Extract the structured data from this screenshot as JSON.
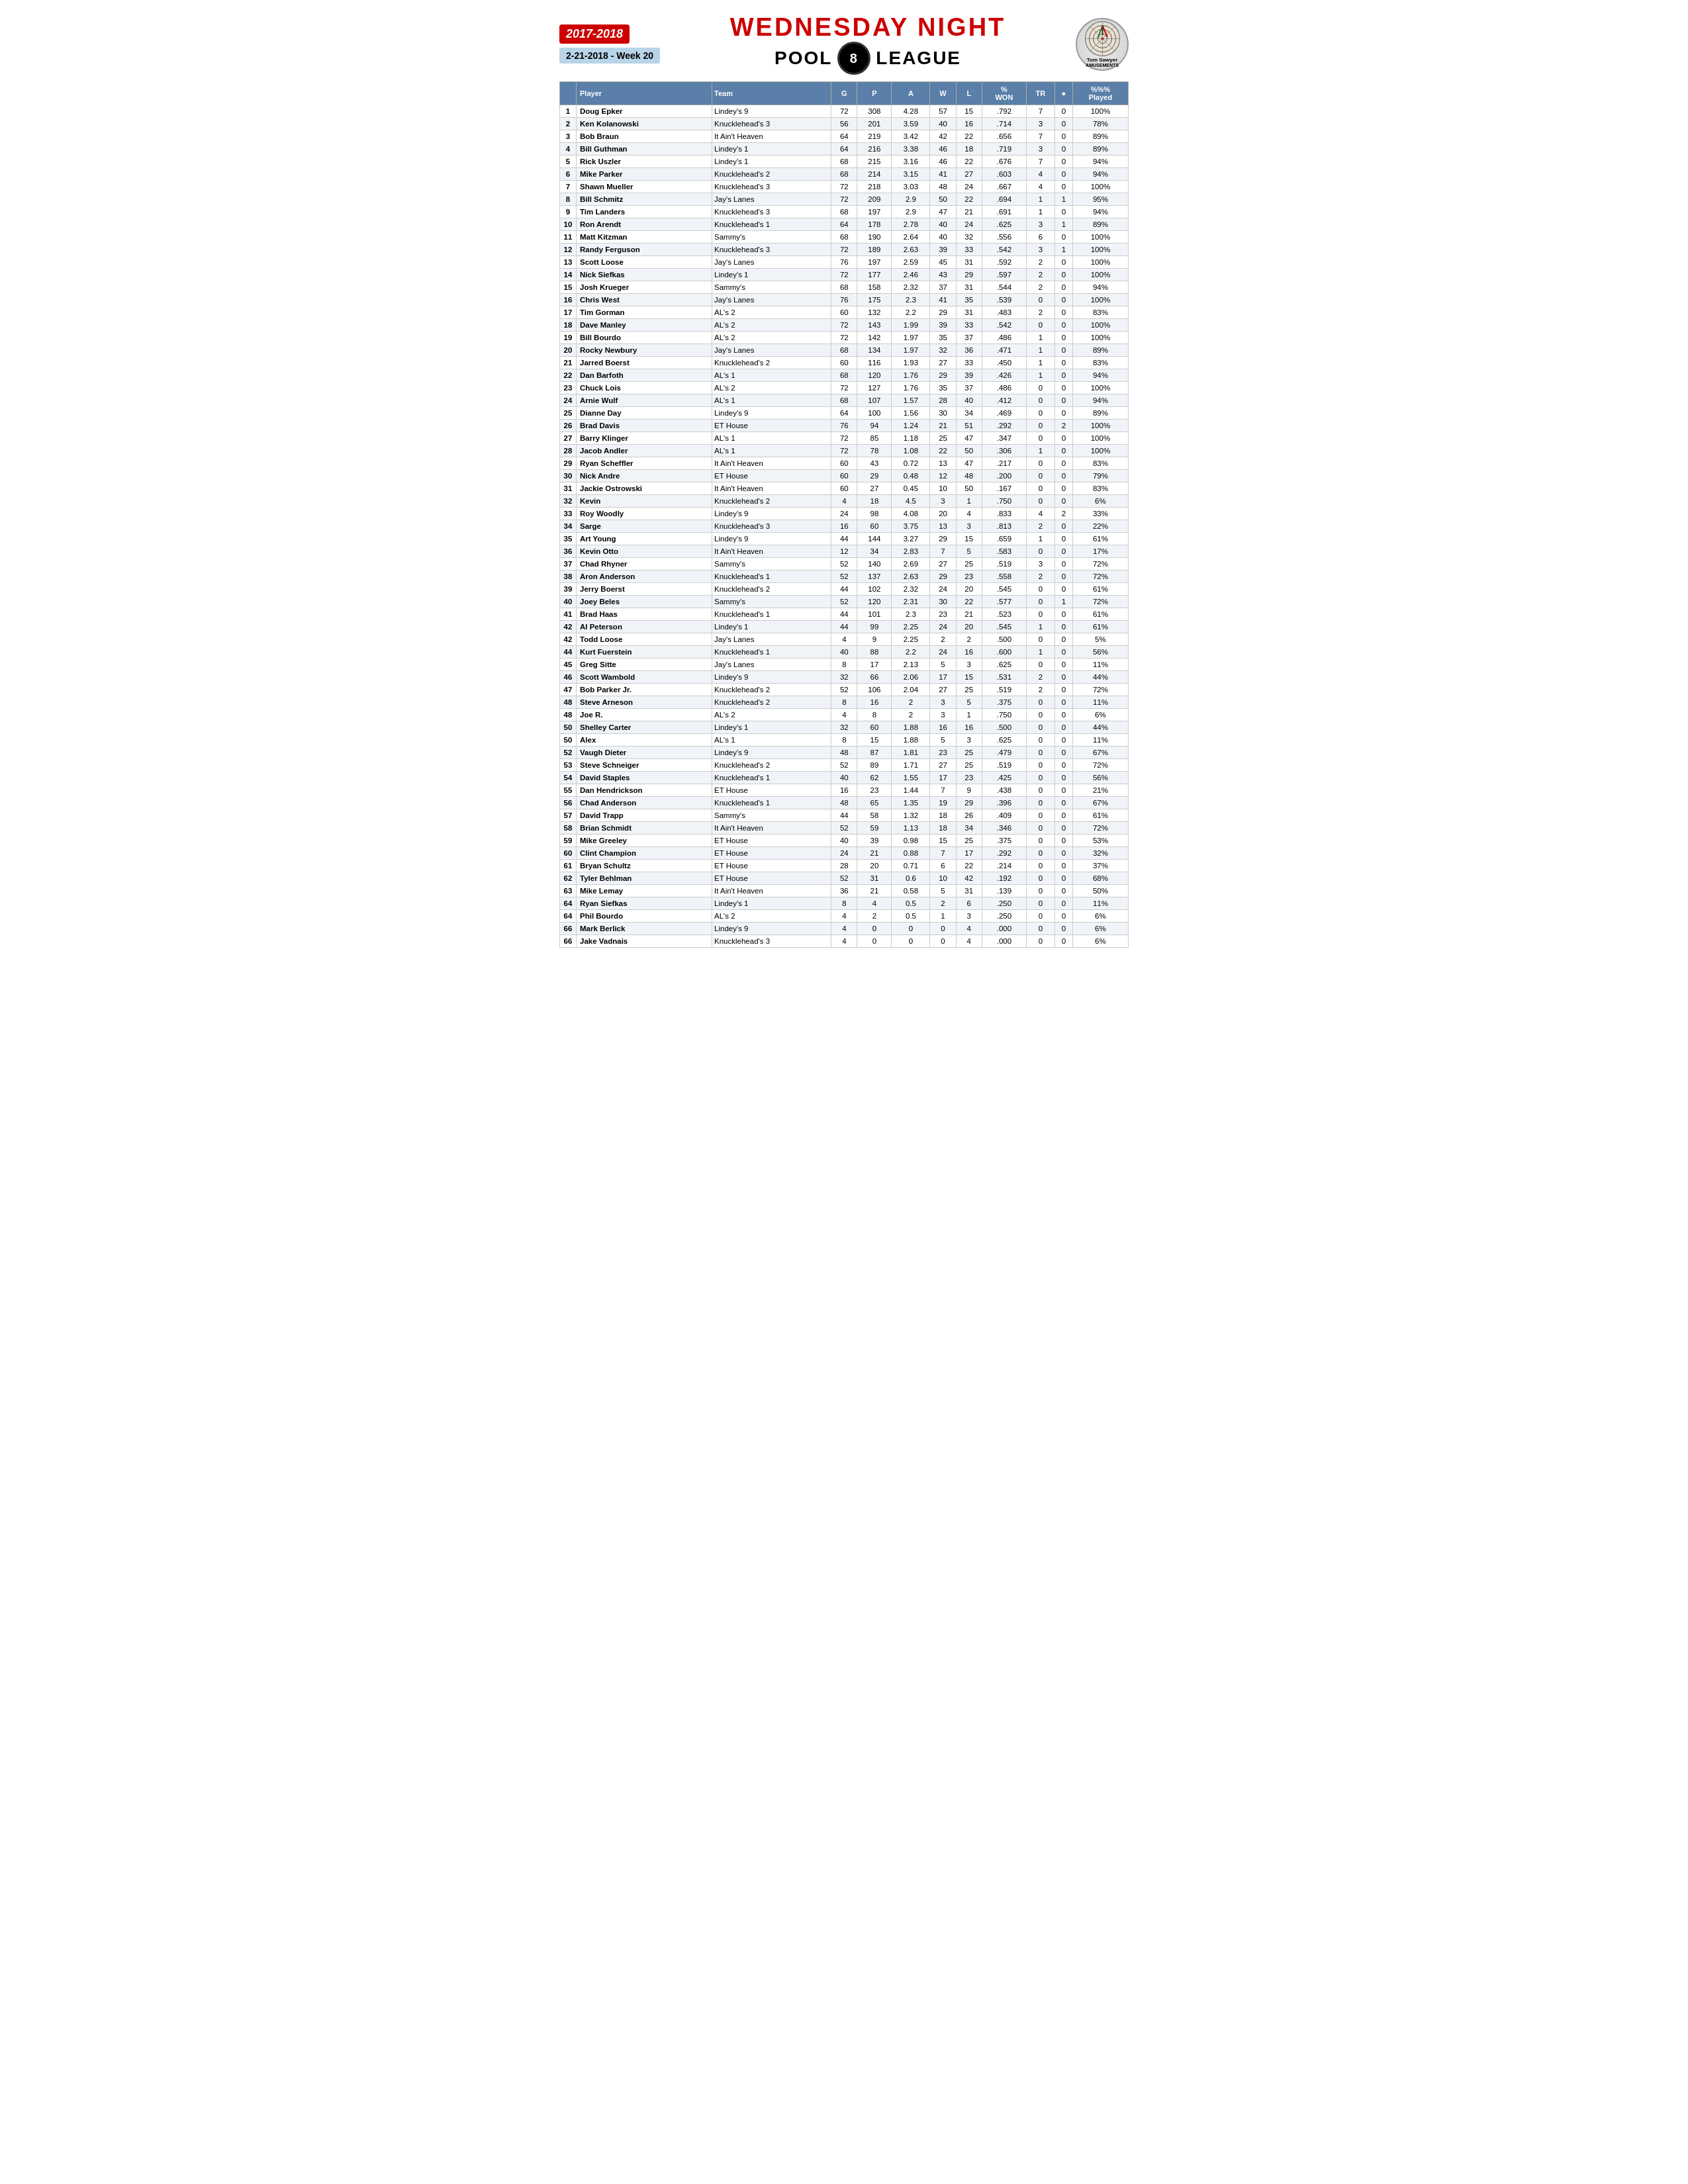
{
  "header": {
    "year": "2017-2018",
    "title_line1": "WEDNESDAY NIGHT",
    "title_line2": "POOL",
    "title_line3": "LEAGUE",
    "date": "2-21-2018 - Week 20",
    "sponsor": "Tom Sawyer",
    "sponsor_sub": "AMUSEMENTS"
  },
  "table": {
    "columns": [
      "",
      "Player",
      "Team",
      "G",
      "P",
      "A",
      "W",
      "L",
      "% WON",
      "TR",
      "8",
      "%%% Played"
    ],
    "rows": [
      [
        1,
        "Doug Epker",
        "Lindey's 9",
        72,
        308,
        4.28,
        57,
        15,
        ".792",
        7,
        0,
        "100%"
      ],
      [
        2,
        "Ken Kolanowski",
        "Knucklehead's 3",
        56,
        201,
        3.59,
        40,
        16,
        ".714",
        3,
        0,
        "78%"
      ],
      [
        3,
        "Bob Braun",
        "It Ain't Heaven",
        64,
        219,
        3.42,
        42,
        22,
        ".656",
        7,
        0,
        "89%"
      ],
      [
        4,
        "Bill Guthman",
        "Lindey's 1",
        64,
        216,
        3.38,
        46,
        18,
        ".719",
        3,
        0,
        "89%"
      ],
      [
        5,
        "Rick Uszler",
        "Lindey's 1",
        68,
        215,
        3.16,
        46,
        22,
        ".676",
        7,
        0,
        "94%"
      ],
      [
        6,
        "Mike Parker",
        "Knucklehead's 2",
        68,
        214,
        3.15,
        41,
        27,
        ".603",
        4,
        0,
        "94%"
      ],
      [
        7,
        "Shawn Mueller",
        "Knucklehead's 3",
        72,
        218,
        3.03,
        48,
        24,
        ".667",
        4,
        0,
        "100%"
      ],
      [
        8,
        "Bill Schmitz",
        "Jay's Lanes",
        72,
        209,
        2.9,
        50,
        22,
        ".694",
        1,
        1,
        "95%"
      ],
      [
        9,
        "Tim Landers",
        "Knucklehead's 3",
        68,
        197,
        2.9,
        47,
        21,
        ".691",
        1,
        0,
        "94%"
      ],
      [
        10,
        "Ron Arendt",
        "Knucklehead's 1",
        64,
        178,
        2.78,
        40,
        24,
        ".625",
        3,
        1,
        "89%"
      ],
      [
        11,
        "Matt Kitzman",
        "Sammy's",
        68,
        190,
        2.64,
        40,
        32,
        ".556",
        6,
        0,
        "100%"
      ],
      [
        12,
        "Randy Ferguson",
        "Knucklehead's 3",
        72,
        189,
        2.63,
        39,
        33,
        ".542",
        3,
        1,
        "100%"
      ],
      [
        13,
        "Scott Loose",
        "Jay's Lanes",
        76,
        197,
        2.59,
        45,
        31,
        ".592",
        2,
        0,
        "100%"
      ],
      [
        14,
        "Nick Siefkas",
        "Lindey's 1",
        72,
        177,
        2.46,
        43,
        29,
        ".597",
        2,
        0,
        "100%"
      ],
      [
        15,
        "Josh Krueger",
        "Sammy's",
        68,
        158,
        2.32,
        37,
        31,
        ".544",
        2,
        0,
        "94%"
      ],
      [
        16,
        "Chris West",
        "Jay's Lanes",
        76,
        175,
        2.3,
        41,
        35,
        ".539",
        0,
        0,
        "100%"
      ],
      [
        17,
        "Tim Gorman",
        "AL's 2",
        60,
        132,
        2.2,
        29,
        31,
        ".483",
        2,
        0,
        "83%"
      ],
      [
        18,
        "Dave Manley",
        "AL's 2",
        72,
        143,
        1.99,
        39,
        33,
        ".542",
        0,
        0,
        "100%"
      ],
      [
        19,
        "Bill Bourdo",
        "AL's 2",
        72,
        142,
        1.97,
        35,
        37,
        ".486",
        1,
        0,
        "100%"
      ],
      [
        20,
        "Rocky Newbury",
        "Jay's Lanes",
        68,
        134,
        1.97,
        32,
        36,
        ".471",
        1,
        0,
        "89%"
      ],
      [
        21,
        "Jarred Boerst",
        "Knucklehead's 2",
        60,
        116,
        1.93,
        27,
        33,
        ".450",
        1,
        0,
        "83%"
      ],
      [
        22,
        "Dan Barfoth",
        "AL's 1",
        68,
        120,
        1.76,
        29,
        39,
        ".426",
        1,
        0,
        "94%"
      ],
      [
        23,
        "Chuck Lois",
        "AL's 2",
        72,
        127,
        1.76,
        35,
        37,
        ".486",
        0,
        0,
        "100%"
      ],
      [
        24,
        "Arnie Wulf",
        "AL's 1",
        68,
        107,
        1.57,
        28,
        40,
        ".412",
        0,
        0,
        "94%"
      ],
      [
        25,
        "Dianne Day",
        "Lindey's 9",
        64,
        100,
        1.56,
        30,
        34,
        ".469",
        0,
        0,
        "89%"
      ],
      [
        26,
        "Brad Davis",
        "ET House",
        76,
        94,
        1.24,
        21,
        51,
        ".292",
        0,
        2,
        "100%"
      ],
      [
        27,
        "Barry Klinger",
        "AL's 1",
        72,
        85,
        1.18,
        25,
        47,
        ".347",
        0,
        0,
        "100%"
      ],
      [
        28,
        "Jacob Andler",
        "AL's 1",
        72,
        78,
        1.08,
        22,
        50,
        ".306",
        1,
        0,
        "100%"
      ],
      [
        29,
        "Ryan Scheffler",
        "It Ain't Heaven",
        60,
        43,
        0.72,
        13,
        47,
        ".217",
        0,
        0,
        "83%"
      ],
      [
        30,
        "Nick Andre",
        "ET House",
        60,
        29,
        0.48,
        12,
        48,
        ".200",
        0,
        0,
        "79%"
      ],
      [
        31,
        "Jackie Ostrowski",
        "It Ain't Heaven",
        60,
        27,
        0.45,
        10,
        50,
        ".167",
        0,
        0,
        "83%"
      ],
      [
        32,
        "Kevin",
        "Knucklehead's 2",
        4,
        18,
        4.5,
        3,
        1,
        ".750",
        0,
        0,
        "6%"
      ],
      [
        33,
        "Roy Woodly",
        "Lindey's 9",
        24,
        98,
        4.08,
        20,
        4,
        ".833",
        4,
        2,
        "33%"
      ],
      [
        34,
        "Sarge",
        "Knucklehead's 3",
        16,
        60,
        3.75,
        13,
        3,
        ".813",
        2,
        0,
        "22%"
      ],
      [
        35,
        "Art Young",
        "Lindey's 9",
        44,
        144,
        3.27,
        29,
        15,
        ".659",
        1,
        0,
        "61%"
      ],
      [
        36,
        "Kevin Otto",
        "It Ain't Heaven",
        12,
        34,
        2.83,
        7,
        5,
        ".583",
        0,
        0,
        "17%"
      ],
      [
        37,
        "Chad Rhyner",
        "Sammy's",
        52,
        140,
        2.69,
        27,
        25,
        ".519",
        3,
        0,
        "72%"
      ],
      [
        38,
        "Aron Anderson",
        "Knucklehead's 1",
        52,
        137,
        2.63,
        29,
        23,
        ".558",
        2,
        0,
        "72%"
      ],
      [
        39,
        "Jerry Boerst",
        "Knucklehead's 2",
        44,
        102,
        2.32,
        24,
        20,
        ".545",
        0,
        0,
        "61%"
      ],
      [
        40,
        "Joey Beles",
        "Sammy's",
        52,
        120,
        2.31,
        30,
        22,
        ".577",
        0,
        1,
        "72%"
      ],
      [
        41,
        "Brad Haas",
        "Knucklehead's 1",
        44,
        101,
        2.3,
        23,
        21,
        ".523",
        0,
        0,
        "61%"
      ],
      [
        42,
        "Al Peterson",
        "Lindey's 1",
        44,
        99,
        2.25,
        24,
        20,
        ".545",
        1,
        0,
        "61%"
      ],
      [
        42,
        "Todd Loose",
        "Jay's Lanes",
        4,
        9,
        2.25,
        2,
        2,
        ".500",
        0,
        0,
        "5%"
      ],
      [
        44,
        "Kurt Fuerstein",
        "Knucklehead's 1",
        40,
        88,
        2.2,
        24,
        16,
        ".600",
        1,
        0,
        "56%"
      ],
      [
        45,
        "Greg Sitte",
        "Jay's Lanes",
        8,
        17,
        2.13,
        5,
        3,
        ".625",
        0,
        0,
        "11%"
      ],
      [
        46,
        "Scott Wambold",
        "Lindey's 9",
        32,
        66,
        2.06,
        17,
        15,
        ".531",
        2,
        0,
        "44%"
      ],
      [
        47,
        "Bob Parker Jr.",
        "Knucklehead's 2",
        52,
        106,
        2.04,
        27,
        25,
        ".519",
        2,
        0,
        "72%"
      ],
      [
        48,
        "Steve Arneson",
        "Knucklehead's 2",
        8,
        16,
        2.0,
        3,
        5,
        ".375",
        0,
        0,
        "11%"
      ],
      [
        48,
        "Joe R.",
        "AL's 2",
        4,
        8,
        2.0,
        3,
        1,
        ".750",
        0,
        0,
        "6%"
      ],
      [
        50,
        "Shelley Carter",
        "Lindey's 1",
        32,
        60,
        1.88,
        16,
        16,
        ".500",
        0,
        0,
        "44%"
      ],
      [
        50,
        "Alex",
        "AL's 1",
        8,
        15,
        1.88,
        5,
        3,
        ".625",
        0,
        0,
        "11%"
      ],
      [
        52,
        "Vaugh Dieter",
        "Lindey's 9",
        48,
        87,
        1.81,
        23,
        25,
        ".479",
        0,
        0,
        "67%"
      ],
      [
        53,
        "Steve Schneiger",
        "Knucklehead's 2",
        52,
        89,
        1.71,
        27,
        25,
        ".519",
        0,
        0,
        "72%"
      ],
      [
        54,
        "David Staples",
        "Knucklehead's 1",
        40,
        62,
        1.55,
        17,
        23,
        ".425",
        0,
        0,
        "56%"
      ],
      [
        55,
        "Dan Hendrickson",
        "ET House",
        16,
        23,
        1.44,
        7,
        9,
        ".438",
        0,
        0,
        "21%"
      ],
      [
        56,
        "Chad Anderson",
        "Knucklehead's 1",
        48,
        65,
        1.35,
        19,
        29,
        ".396",
        0,
        0,
        "67%"
      ],
      [
        57,
        "David Trapp",
        "Sammy's",
        44,
        58,
        1.32,
        18,
        26,
        ".409",
        0,
        0,
        "61%"
      ],
      [
        58,
        "Brian Schmidt",
        "It Ain't Heaven",
        52,
        59,
        1.13,
        18,
        34,
        ".346",
        0,
        0,
        "72%"
      ],
      [
        59,
        "Mike Greeley",
        "ET House",
        40,
        39,
        0.98,
        15,
        25,
        ".375",
        0,
        0,
        "53%"
      ],
      [
        60,
        "Clint Champion",
        "ET House",
        24,
        21,
        0.88,
        7,
        17,
        ".292",
        0,
        0,
        "32%"
      ],
      [
        61,
        "Bryan Schultz",
        "ET House",
        28,
        20,
        0.71,
        6,
        22,
        ".214",
        0,
        0,
        "37%"
      ],
      [
        62,
        "Tyler Behlman",
        "ET House",
        52,
        31,
        0.6,
        10,
        42,
        ".192",
        0,
        0,
        "68%"
      ],
      [
        63,
        "Mike Lemay",
        "It Ain't Heaven",
        36,
        21,
        0.58,
        5,
        31,
        ".139",
        0,
        0,
        "50%"
      ],
      [
        64,
        "Ryan Siefkas",
        "Lindey's 1",
        8,
        4,
        0.5,
        2,
        6,
        ".250",
        0,
        0,
        "11%"
      ],
      [
        64,
        "Phil Bourdo",
        "AL's 2",
        4,
        2,
        0.5,
        1,
        3,
        ".250",
        0,
        0,
        "6%"
      ],
      [
        66,
        "Mark Berlick",
        "Lindey's 9",
        4,
        0,
        0.0,
        0,
        4,
        ".000",
        0,
        0,
        "6%"
      ],
      [
        66,
        "Jake Vadnais",
        "Knucklehead's 3",
        4,
        0,
        0.0,
        0,
        4,
        ".000",
        0,
        0,
        "6%"
      ]
    ]
  }
}
